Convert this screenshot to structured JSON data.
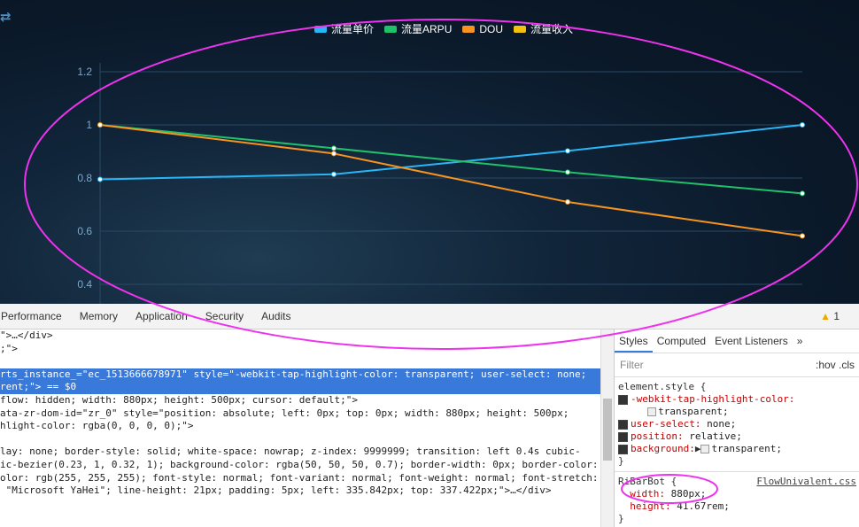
{
  "chart_data": {
    "type": "line",
    "x": [
      0,
      1,
      2,
      3
    ],
    "ylim": [
      0.4,
      1.2
    ],
    "yticks": [
      "1.2",
      "1",
      "0.8",
      "0.6",
      "0.4"
    ],
    "series": [
      {
        "name": "流量单价",
        "color": "#29b6f6",
        "values": [
          0.795,
          0.814,
          0.902,
          1.0
        ]
      },
      {
        "name": "流量ARPU",
        "color": "#1fc26a",
        "values": [
          1.0,
          0.912,
          0.822,
          0.742
        ]
      },
      {
        "name": "DOU",
        "color": "#f7931e",
        "values": [
          1.0,
          0.892,
          0.71,
          0.582
        ]
      },
      {
        "name": "流量收入",
        "color": "#f4c20d",
        "values": []
      }
    ]
  },
  "devtools": {
    "tabs": [
      "Performance",
      "Memory",
      "Application",
      "Security",
      "Audits"
    ],
    "warning_count": "1",
    "elements_lines": [
      "\">…</div>",
      ";\">",
      "",
      "rts_instance_=\"ec_1513666678971\" style=\"-webkit-tap-highlight-color: transparent; user-select: none;",
      "rent;\"> == $0",
      "flow: hidden; width: 880px; height: 500px; cursor: default;\">",
      "ata-zr-dom-id=\"zr_0\" style=\"position: absolute; left: 0px; top: 0px; width: 880px; height: 500px;",
      "hlight-color: rgba(0, 0, 0, 0);\">",
      "",
      "lay: none; border-style: solid; white-space: nowrap; z-index: 9999999; transition: left 0.4s cubic-",
      "ic-bezier(0.23, 1, 0.32, 1); background-color: rgba(50, 50, 50, 0.7); border-width: 0px; border-color:",
      "olor: rgb(255, 255, 255); font-style: normal; font-variant: normal; font-weight: normal; font-stretch:",
      " \"Microsoft YaHei\"; line-height: 21px; padding: 5px; left: 335.842px; top: 337.422px;\">…</div>"
    ],
    "styles": {
      "tabs": [
        "Styles",
        "Computed",
        "Event Listeners",
        "»"
      ],
      "filter_placeholder": "Filter",
      "filter_right": ":hov  .cls",
      "element_style_selector": "element.style {",
      "props": [
        {
          "name": "-webkit-tap-highlight-color:",
          "value": "transparent;"
        },
        {
          "name": "user-select:",
          "value": "none;"
        },
        {
          "name": "position:",
          "value": "relative;"
        },
        {
          "name": "background:",
          "value": "transparent;"
        }
      ],
      "close": "}",
      "rule2_selector": "RiBarBot {",
      "rule2_source": "FlowUnivalent.css",
      "rule2_props": [
        {
          "name": "width:",
          "value": "880px;"
        },
        {
          "name": "height:",
          "value": "41.67rem;"
        }
      ]
    }
  }
}
